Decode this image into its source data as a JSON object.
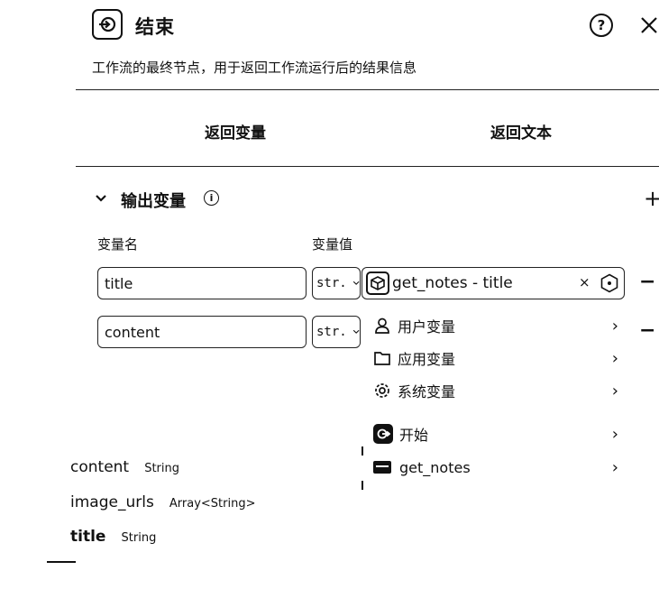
{
  "panel": {
    "title": "结束",
    "description": "工作流的最终节点，用于返回工作流运行后的结果信息",
    "help_icon": "question-circle-icon",
    "close_icon": "close-icon",
    "node_icon": "end-node-icon"
  },
  "tabs": [
    {
      "label": "返回变量"
    },
    {
      "label": "返回文本"
    }
  ],
  "output": {
    "section_title": "输出变量",
    "add_label": "+",
    "col_name": "变量名",
    "col_value": "变量值",
    "rows": [
      {
        "name": "title",
        "type": "str.",
        "value": "get_notes - title",
        "remove": "−"
      },
      {
        "name": "content",
        "type": "str.",
        "remove": "−"
      }
    ]
  },
  "dropdown": {
    "items": [
      {
        "label": "用户变量",
        "icon": "user-icon"
      },
      {
        "label": "应用变量",
        "icon": "folder-icon"
      },
      {
        "label": "系统变量",
        "icon": "gear-icon"
      },
      {
        "label": "开始",
        "icon": "start-node-icon"
      },
      {
        "label": "get_notes",
        "icon": "plugin-icon"
      }
    ]
  },
  "variables": [
    {
      "name": "content",
      "type": "String"
    },
    {
      "name": "image_urls",
      "type": "Array<String>"
    },
    {
      "name": "title",
      "type": "String"
    }
  ]
}
